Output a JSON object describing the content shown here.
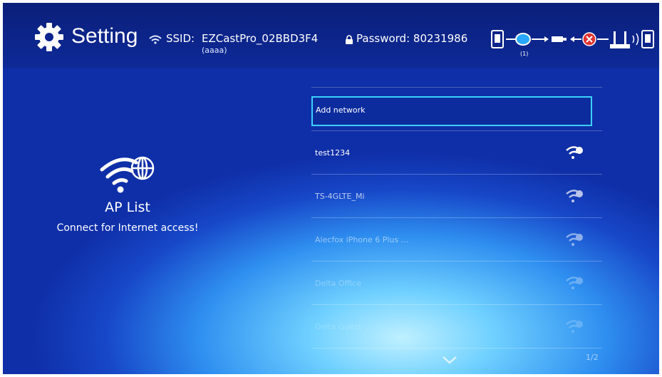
{
  "header": {
    "title": "Setting",
    "ssid_label": "SSID:",
    "ssid_value": "EZCastPro_02BBD3F4",
    "ssid_sub": "(aaaa)",
    "password_label": "Password:",
    "password_value": "80231986",
    "connection_count": "(1)",
    "icons": [
      "gear-icon",
      "wifi-small-icon",
      "lock-icon",
      "phone-icon",
      "dongle-icon",
      "disconnected-icon",
      "router-icon"
    ]
  },
  "left_panel": {
    "icon": "wifi-globe-icon",
    "title": "AP List",
    "subtitle": "Connect for Internet access!"
  },
  "list": {
    "add_label": "Add network",
    "networks": [
      {
        "name": "test1234"
      },
      {
        "name": "TS-4GLTE_Mi"
      },
      {
        "name": "Alecfox iPhone 6 Plus ..."
      },
      {
        "name": "Delta Office"
      },
      {
        "name": "Delta Guest"
      }
    ],
    "page": "1/2"
  },
  "colors": {
    "focus": "#3cd0ff",
    "header": "#0e2a98"
  }
}
